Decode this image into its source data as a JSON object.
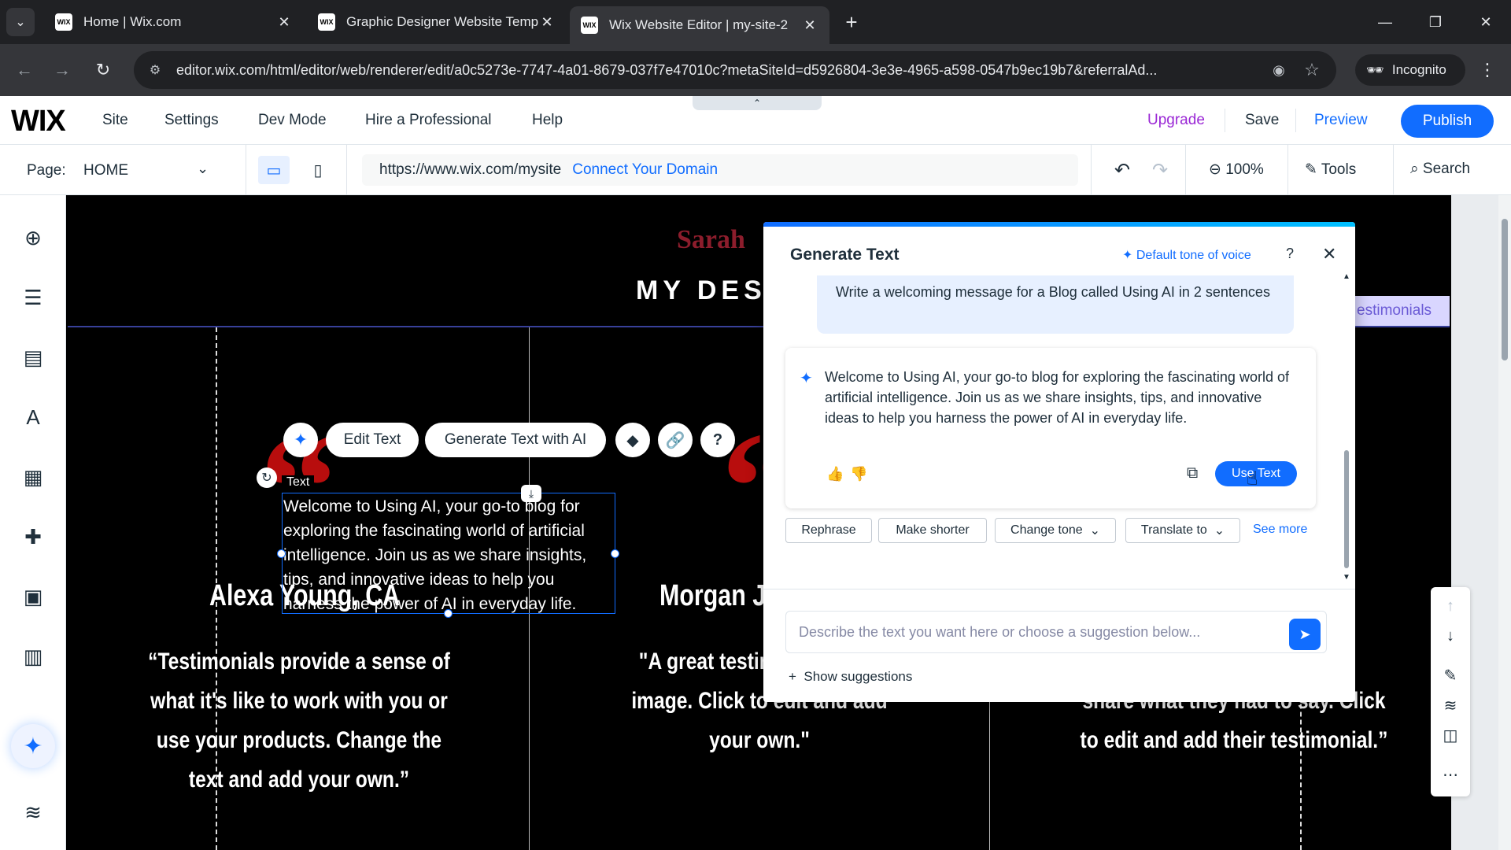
{
  "browser": {
    "tabs": [
      {
        "title": "Home | Wix.com",
        "active": false
      },
      {
        "title": "Graphic Designer Website Temp",
        "active": false
      },
      {
        "title": "Wix Website Editor | my-site-2",
        "active": true
      }
    ],
    "address": "editor.wix.com/html/editor/web/renderer/edit/a0c5273e-7747-4a01-8679-037f7e47010c?metaSiteId=d5926804-3e3e-4965-a598-0547b9ec19b7&referralAd...",
    "incognito_label": "Incognito",
    "favicon_text": "WIX"
  },
  "wix_top": {
    "logo": "WIX",
    "menu": [
      "Site",
      "Settings",
      "Dev Mode",
      "Hire a Professional",
      "Help"
    ],
    "upgrade": "Upgrade",
    "save": "Save",
    "preview": "Preview",
    "publish": "Publish"
  },
  "pagebar": {
    "page_label": "Page:",
    "page_name": "HOME",
    "site_url": "https://www.wix.com/mysite",
    "connect_domain": "Connect Your Domain",
    "zoom": "100%",
    "tools": "Tools",
    "search": "Search"
  },
  "site": {
    "name": "Sarah",
    "title": "MY DESI",
    "testimonials_tab": "estimonials",
    "selected_label": "Text",
    "selected_text": "Welcome to Using AI, your go-to blog for exploring the fascinating world of artificial intelligence. Join us as we share insights, tips, and innovative ideas to help you harness the power of AI in everyday life.",
    "people": [
      "Alexa Young, CA",
      "Morgan Ja"
    ],
    "testimonials": [
      "“Testimonials provide a sense of what it's like to work with you or use your products. Change the text and add your own.”",
      "\"A great testimoni brand's image. Click to edit and add your own.\"",
      "share what they had to say. Click to edit and add their testimonial.”"
    ]
  },
  "floating_toolbar": {
    "edit_text": "Edit Text",
    "generate_ai": "Generate Text with AI"
  },
  "panel": {
    "title": "Generate Text",
    "tone": "Default tone of voice",
    "prompt": "Write a welcoming message for a Blog called Using AI in 2 sentences",
    "answer": "Welcome to Using AI, your go-to blog for exploring the fascinating world of artificial intelligence. Join us as we share insights, tips, and innovative ideas to help you harness the power of AI in everyday life.",
    "use_text": "Use Text",
    "actions": [
      "Rephrase",
      "Make shorter",
      "Change tone",
      "Translate to"
    ],
    "see_more": "See more",
    "input_placeholder": "Describe the text you want here or choose a suggestion below...",
    "show_suggestions": "Show suggestions"
  },
  "colors": {
    "wix_blue": "#116dff",
    "upgrade_purple": "#9a27d5",
    "quote_red": "#b80d0d"
  }
}
